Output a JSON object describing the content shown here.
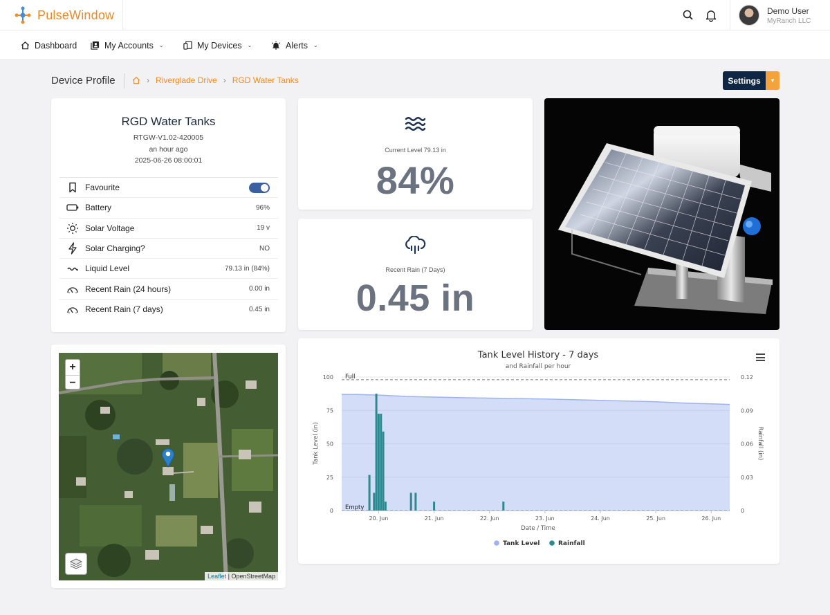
{
  "app": {
    "name": "PulseWindow"
  },
  "user": {
    "name": "Demo User",
    "org": "MyRanch LLC"
  },
  "nav": {
    "dashboard": "Dashboard",
    "accounts": "My Accounts",
    "devices": "My Devices",
    "alerts": "Alerts"
  },
  "page": {
    "title": "Device Profile",
    "breadcrumb": [
      "Riverglade Drive",
      "RGD Water Tanks"
    ],
    "settings_label": "Settings"
  },
  "device": {
    "name": "RGD Water Tanks",
    "id": "RTGW-V1.02-420005",
    "last_seen": "an hour ago",
    "timestamp": "2025-06-26 08:00:01",
    "properties": [
      {
        "label": "Favourite",
        "value": "",
        "icon": "bookmark-icon"
      },
      {
        "label": "Battery",
        "value": "96%",
        "icon": "battery-icon"
      },
      {
        "label": "Solar Voltage",
        "value": "19 v",
        "icon": "sun-icon"
      },
      {
        "label": "Solar Charging?",
        "value": "NO",
        "icon": "lightning-icon"
      },
      {
        "label": "Liquid Level",
        "value": "79.13 in (84%)",
        "icon": "wave-icon"
      },
      {
        "label": "Recent Rain (24 hours)",
        "value": "0.00 in",
        "icon": "rain-gauge-icon"
      },
      {
        "label": "Recent Rain (7 days)",
        "value": "0.45 in",
        "icon": "rain-gauge-icon"
      }
    ],
    "favourite": true
  },
  "stats": {
    "level_label": "Current Level 79.13 in",
    "level_value": "84%",
    "rain_label": "Recent Rain (7 Days)",
    "rain_value": "0.45 in"
  },
  "map": {
    "zoom_in": "+",
    "zoom_out": "−",
    "attribution_leaflet": "Leaflet",
    "attribution_osm": "| OpenStreetMap"
  },
  "chart_data": {
    "type": "area",
    "title": "Tank Level History - 7 days",
    "subtitle": "and Rainfall per hour",
    "xlabel": "Date / Time",
    "ylabel": "Tank Level (in)",
    "y2label": "Rainfall (in)",
    "ylim": [
      0,
      100
    ],
    "y2lim": [
      0,
      0.12
    ],
    "y_ticks": [
      0,
      25,
      50,
      75,
      100
    ],
    "y2_ticks": [
      "0",
      "0.03",
      "0.06",
      "0.09",
      "0.12"
    ],
    "x_range": [
      "2025-06-19T08:00",
      "2025-06-26T08:00"
    ],
    "x_ticks": [
      "20. Jun",
      "21. Jun",
      "22. Jun",
      "23. Jun",
      "24. Jun",
      "25. Jun",
      "26. Jun"
    ],
    "plot_lines": [
      {
        "label": "Full",
        "value": 98
      },
      {
        "label": "Empty",
        "value": 0
      }
    ],
    "legend": "bottom",
    "series": [
      {
        "name": "Tank Level",
        "color": "#9db3f0",
        "points": [
          [
            "2025-06-19T08:00",
            87
          ],
          [
            "2025-06-19T14:00",
            87
          ],
          [
            "2025-06-20T00:00",
            86.5
          ],
          [
            "2025-06-20T12:00",
            85.5
          ],
          [
            "2025-06-21T00:00",
            85
          ],
          [
            "2025-06-21T12:00",
            84.5
          ],
          [
            "2025-06-22T00:00",
            84.2
          ],
          [
            "2025-06-23T00:00",
            83.5
          ],
          [
            "2025-06-24T00:00",
            82.5
          ],
          [
            "2025-06-25T00:00",
            81.5
          ],
          [
            "2025-06-25T12:00",
            80.5
          ],
          [
            "2025-06-26T08:00",
            79.5
          ]
        ]
      },
      {
        "name": "Rainfall",
        "color": "#2a8a8f",
        "points": [
          [
            "2025-06-19T20:00",
            0.032
          ],
          [
            "2025-06-19T22:00",
            0.016
          ],
          [
            "2025-06-19T23:00",
            0.105
          ],
          [
            "2025-06-20T00:00",
            0.087
          ],
          [
            "2025-06-20T01:00",
            0.087
          ],
          [
            "2025-06-20T02:00",
            0.071
          ],
          [
            "2025-06-20T03:00",
            0.008
          ],
          [
            "2025-06-20T14:00",
            0.016
          ],
          [
            "2025-06-20T16:00",
            0.016
          ],
          [
            "2025-06-21T00:00",
            0.008
          ],
          [
            "2025-06-22T06:00",
            0.008
          ]
        ]
      }
    ]
  }
}
